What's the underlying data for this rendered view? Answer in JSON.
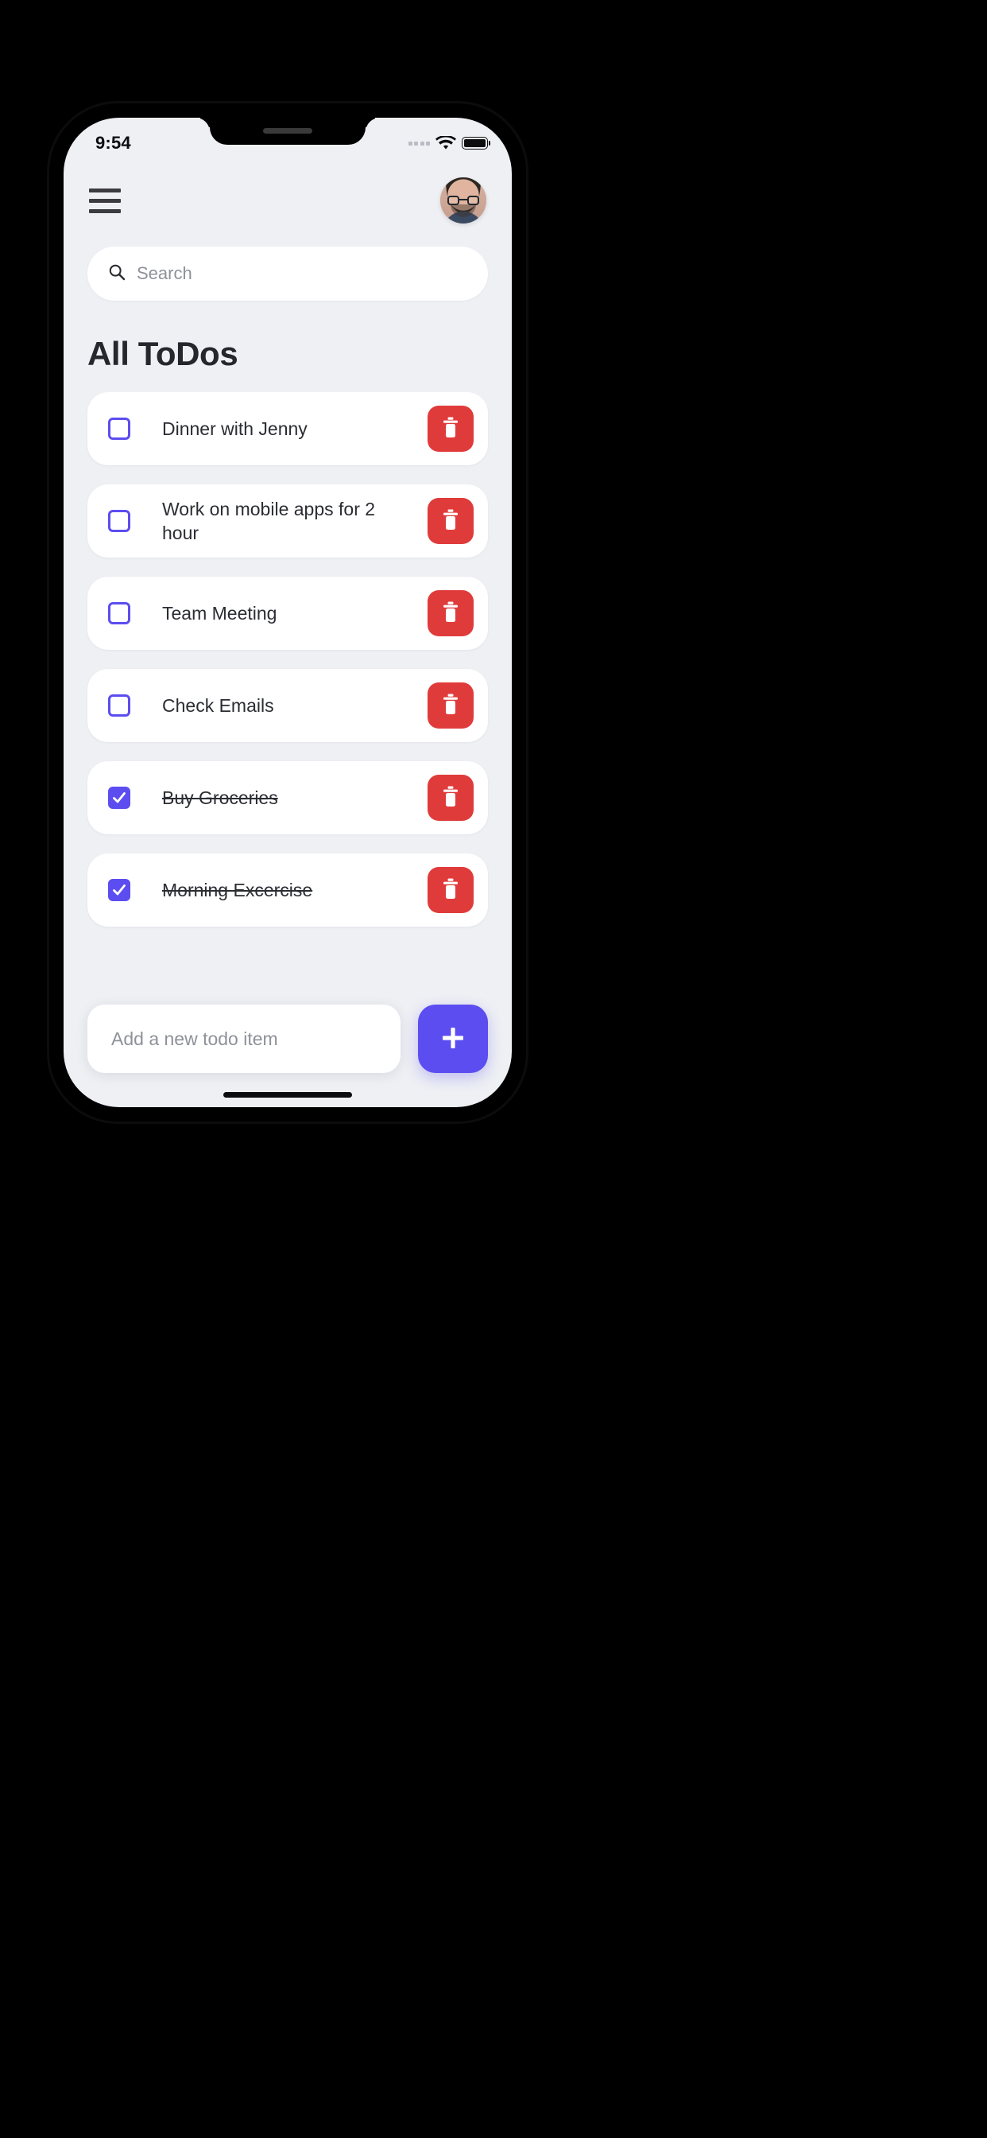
{
  "status_bar": {
    "time": "9:54",
    "signal_icon": "signal-dots-icon",
    "wifi_icon": "wifi-icon",
    "battery_icon": "battery-full-icon"
  },
  "app_bar": {
    "menu_icon": "hamburger-menu-icon",
    "avatar_label": "user-avatar"
  },
  "search": {
    "icon": "search-icon",
    "value": "",
    "placeholder": "Search"
  },
  "main": {
    "title": "All ToDos"
  },
  "todos": [
    {
      "label": "Dinner with Jenny",
      "done": false,
      "delete_icon": "trash-icon"
    },
    {
      "label": "Work on mobile apps for 2 hour",
      "done": false,
      "delete_icon": "trash-icon"
    },
    {
      "label": "Team Meeting",
      "done": false,
      "delete_icon": "trash-icon"
    },
    {
      "label": "Check Emails",
      "done": false,
      "delete_icon": "trash-icon"
    },
    {
      "label": "Buy Groceries",
      "done": true,
      "delete_icon": "trash-icon"
    },
    {
      "label": "Morning Excercise",
      "done": true,
      "delete_icon": "trash-icon"
    }
  ],
  "add_bar": {
    "value": "",
    "placeholder": "Add a new todo item",
    "add_icon": "plus-icon"
  },
  "colors": {
    "accent": "#5c4df0",
    "danger": "#e03b3b",
    "screen_bg": "#eef0f4",
    "card_bg": "#ffffff",
    "text": "#2b2d33",
    "placeholder": "#8e9199"
  }
}
